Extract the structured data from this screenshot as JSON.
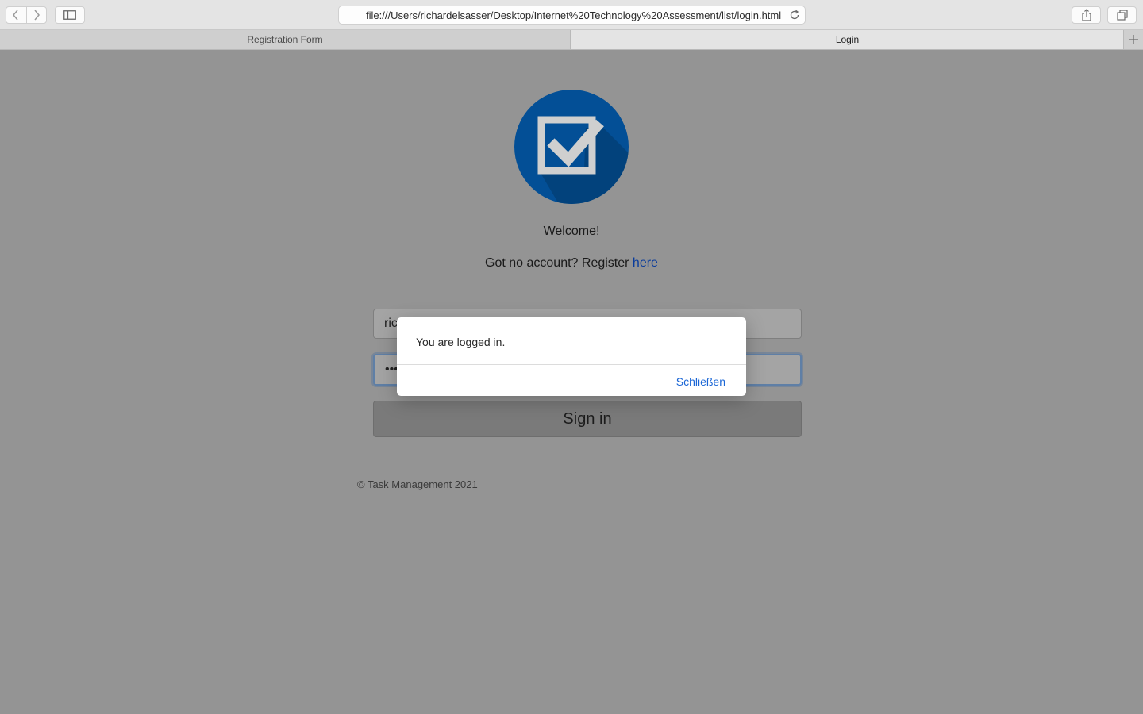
{
  "browser": {
    "url": "file:///Users/richardelsasser/Desktop/Internet%20Technology%20Assessment/list/login.html",
    "tabs": [
      {
        "label": "Registration Form",
        "active": false
      },
      {
        "label": "Login",
        "active": true
      }
    ],
    "icons": [
      "back-icon",
      "forward-icon",
      "sidebar-icon",
      "reload-icon",
      "share-icon",
      "tabs-overview-icon",
      "new-tab-icon"
    ]
  },
  "page": {
    "logo_icon": "checkbox-logo-icon",
    "logo_color": "#0b5fb0",
    "welcome": "Welcome!",
    "register_prefix": "Got no account? Register",
    "register_link": "here",
    "username_value": "ric",
    "password_value": "•••",
    "signin_label": "Sign in",
    "footer": "© Task Management 2021"
  },
  "dialog": {
    "message": "You are logged in.",
    "close_label": "Schließen",
    "accent": "#1a66d6"
  }
}
